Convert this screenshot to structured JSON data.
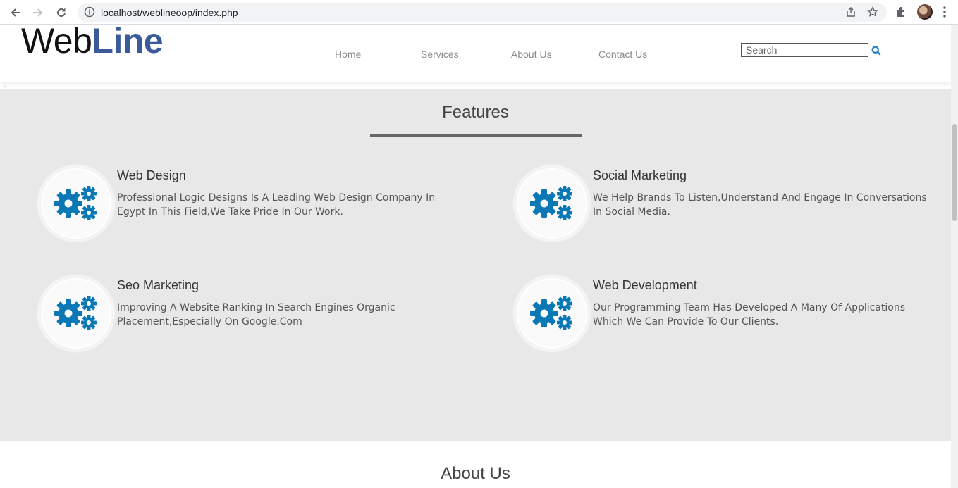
{
  "browser": {
    "url": "localhost/weblineoop/index.php"
  },
  "header": {
    "logo_web": "Web",
    "logo_line": "Line",
    "nav": [
      {
        "label": "Home"
      },
      {
        "label": "Services"
      },
      {
        "label": "About Us"
      },
      {
        "label": "Contact Us"
      }
    ],
    "search": {
      "placeholder": "Search"
    },
    "stray_mark": ","
  },
  "features": {
    "title": "Features",
    "items": [
      {
        "title": "Web Design",
        "description": "Professional Logic Designs Is A Leading Web Design Company In Egypt In This Field,We Take Pride In Our Work.",
        "icon": "gears-icon"
      },
      {
        "title": "Social Marketing",
        "description": "We Help Brands To Listen,Understand And Engage In Conversations In Social Media.",
        "icon": "gears-icon"
      },
      {
        "title": "Seo Marketing",
        "description": "Improving A Website Ranking In Search Engines Organic Placement,Especially On Google.Com",
        "icon": "gears-icon"
      },
      {
        "title": "Web Development",
        "description": "Our Programming Team Has Developed A Many Of Applications Which We Can Provide To Our Clients.",
        "icon": "gears-icon"
      }
    ]
  },
  "about": {
    "title": "About Us"
  },
  "colors": {
    "logo_accent": "#3b5a9a",
    "icon_blue": "#0a78b5",
    "section_bg": "#e8e8e8"
  }
}
